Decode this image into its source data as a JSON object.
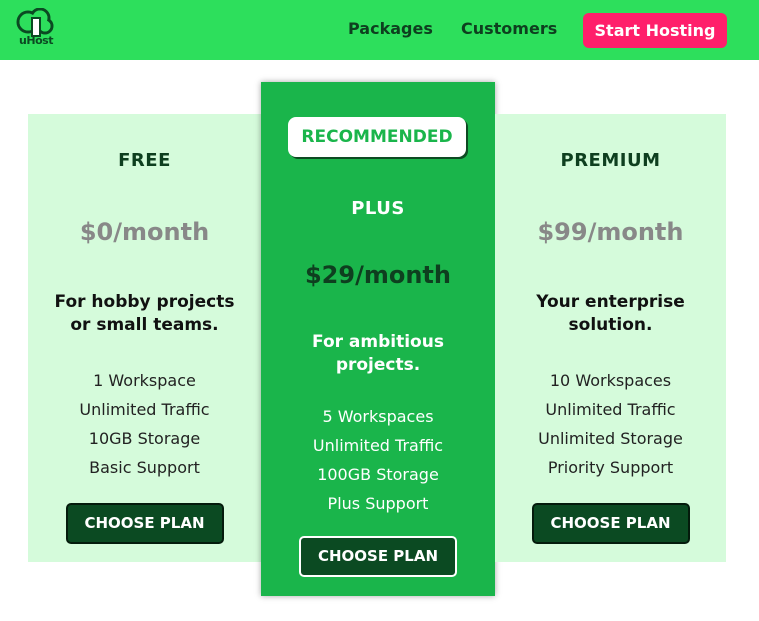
{
  "brand": {
    "logo_text": "uHost",
    "color": "#2ddf5c"
  },
  "nav": {
    "links": [
      "Packages",
      "Customers"
    ],
    "cta_label": "Start Hosting",
    "cta_color": "#ff1f6b"
  },
  "plans": [
    {
      "name": "FREE",
      "price": "$0/month",
      "description": "For hobby projects or small teams.",
      "features": [
        "1 Workspace",
        "Unlimited Traffic",
        "10GB Storage",
        "Basic Support"
      ],
      "button_label": "CHOOSE PLAN"
    },
    {
      "badge": "RECOMMENDED",
      "name": "PLUS",
      "price": "$29/month",
      "description": "For ambitious projects.",
      "features": [
        "5 Workspaces",
        "Unlimited Traffic",
        "100GB Storage",
        "Plus Support"
      ],
      "button_label": "CHOOSE PLAN"
    },
    {
      "name": "PREMIUM",
      "price": "$99/month",
      "description": "Your enterprise solution.",
      "features": [
        "10 Workspaces",
        "Unlimited Traffic",
        "Unlimited Storage",
        "Priority Support"
      ],
      "button_label": "CHOOSE PLAN"
    }
  ],
  "colors": {
    "card_bg": "#d5fbdb",
    "recommended_bg": "#1ab54b",
    "button_bg": "#0b4a22"
  },
  "icons": {
    "logo": "tree-house-logo-icon"
  }
}
